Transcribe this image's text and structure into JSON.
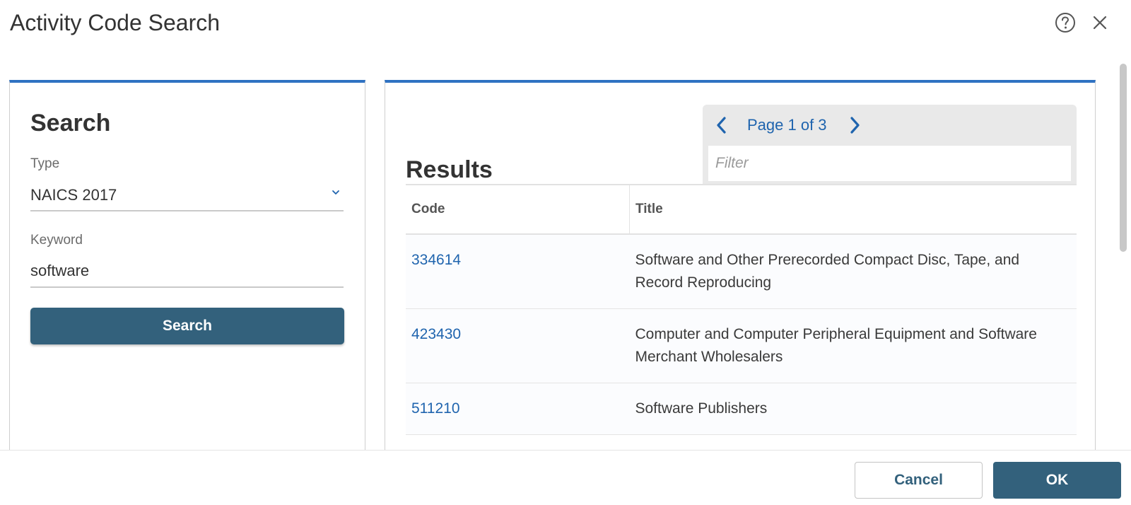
{
  "dialog": {
    "title": "Activity Code Search",
    "help_icon": "help-circle-icon",
    "close_icon": "close-icon"
  },
  "search_panel": {
    "heading": "Search",
    "type_label": "Type",
    "type_value": "NAICS 2017",
    "keyword_label": "Keyword",
    "keyword_value": "software",
    "search_button": "Search"
  },
  "results_panel": {
    "heading": "Results",
    "pager": {
      "text": "Page 1 of 3",
      "prev_icon": "chevron-left-icon",
      "next_icon": "chevron-right-icon"
    },
    "filter_placeholder": "Filter",
    "columns": [
      "Code",
      "Title"
    ],
    "rows": [
      {
        "code": "334614",
        "title": "Software and Other Prerecorded Compact Disc, Tape, and Record Reproducing"
      },
      {
        "code": "423430",
        "title": "Computer and Computer Peripheral Equipment and Software Merchant Wholesalers"
      },
      {
        "code": "511210",
        "title": "Software Publishers"
      }
    ]
  },
  "footer": {
    "cancel_button": "Cancel",
    "ok_button": "OK"
  },
  "colors": {
    "accent_blue": "#2f72c2",
    "link_blue": "#1f64ae",
    "button_teal": "#33617c"
  }
}
